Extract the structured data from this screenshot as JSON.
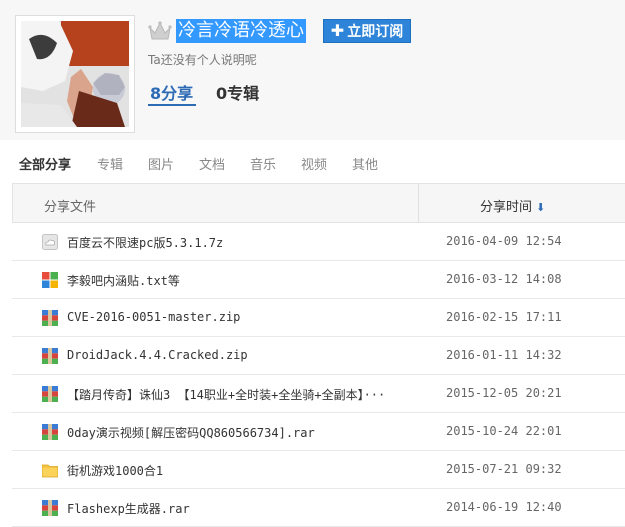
{
  "profile": {
    "username": "冷言冷语冷透心",
    "subscribe_label": "立即订阅",
    "description": "Ta还没有个人说明呢",
    "shares_label": "8分享",
    "albums_label": "0专辑"
  },
  "tabs": [
    "全部分享",
    "专辑",
    "图片",
    "文档",
    "音乐",
    "视频",
    "其他"
  ],
  "table": {
    "col_name": "分享文件",
    "col_time": "分享时间",
    "rows": [
      {
        "name": "百度云不限速pc版5.3.1.7z",
        "time": "2016-04-09 12:54",
        "icon": "cloud-icon"
      },
      {
        "name": "李毅吧内涵贴.txt等",
        "time": "2016-03-12 14:08",
        "icon": "multi-file-icon"
      },
      {
        "name": "CVE-2016-0051-master.zip",
        "time": "2016-02-15 17:11",
        "icon": "archive-icon"
      },
      {
        "name": "DroidJack.4.4.Cracked.zip",
        "time": "2016-01-11 14:32",
        "icon": "archive-icon"
      },
      {
        "name": "【踏月传奇】诛仙3 【14职业+全时装+全坐骑+全副本】···",
        "time": "2015-12-05 20:21",
        "icon": "archive-icon"
      },
      {
        "name": "0day演示视频[解压密码QQ860566734].rar",
        "time": "2015-10-24 22:01",
        "icon": "archive-icon"
      },
      {
        "name": "街机游戏1000合1",
        "time": "2015-07-21 09:32",
        "icon": "folder-icon"
      },
      {
        "name": "Flashexp生成器.rar",
        "time": "2014-06-19 12:40",
        "icon": "archive-icon"
      }
    ]
  },
  "colors": {
    "accent": "#2d6bb5",
    "username_highlight": "#3399ff",
    "subscribe_bg": "#2d84d8"
  }
}
